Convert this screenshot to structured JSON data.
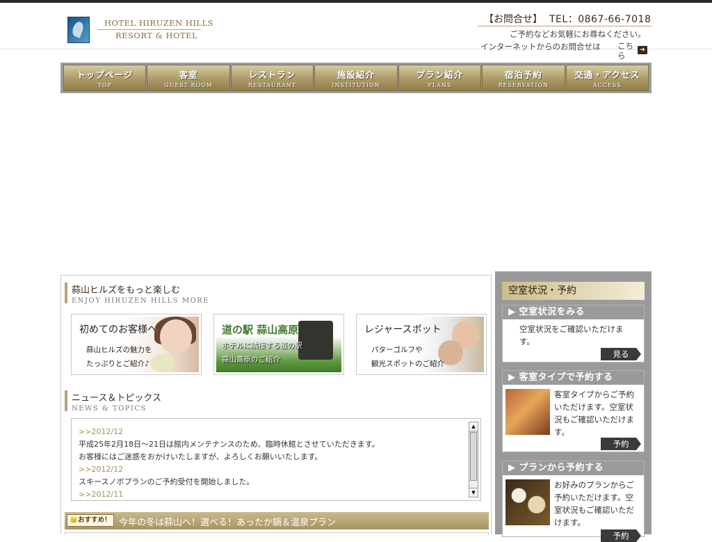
{
  "header": {
    "logo_line1": "HOTEL HIRUZEN HILLS",
    "logo_line2": "RESORT & HOTEL",
    "contact_title": "【お問合せ】",
    "contact_tel": "TEL：0867-66-7018",
    "contact_line1": "ご予約などお気軽にお尋ねください。",
    "contact_line2": "インターネットからのお問合せは",
    "contact_more": "こちら"
  },
  "nav": [
    {
      "jp": "トップページ",
      "en": "TOP"
    },
    {
      "jp": "客室",
      "en": "GUEST ROOM"
    },
    {
      "jp": "レストラン",
      "en": "RESTAURANT"
    },
    {
      "jp": "施設紹介",
      "en": "INSTITUTION"
    },
    {
      "jp": "プラン紹介",
      "en": "PLANS"
    },
    {
      "jp": "宿泊予約",
      "en": "RESERVATION"
    },
    {
      "jp": "交通・アクセス",
      "en": "ACCESS"
    }
  ],
  "enjoy": {
    "title_jp": "蒜山ヒルズをもっと楽しむ",
    "title_en": "ENJOY HIRUZEN HILLS MORE",
    "banners": [
      {
        "title": "初めてのお客様へ",
        "sub1": "蒜山ヒルズの魅力を",
        "sub2": "たっぷりとご紹介♪"
      },
      {
        "title": "道の駅 蒜山高原",
        "sub1": "ホテルに隣接する道の駅",
        "sub2": "蒜山高原のご紹介"
      },
      {
        "title": "レジャースポット",
        "sub1": "パターゴルフや",
        "sub2": "観光スポットのご紹介"
      }
    ]
  },
  "news": {
    "title_jp": "ニュース＆トピックス",
    "title_en": "NEWS & TOPICS",
    "items": [
      {
        "date": ">>2012/12",
        "lines": [
          "平成25年2月18日～21日は館内メンテナンスのため、臨時休館とさせていただきます。",
          "お客様にはご迷惑をおかけいたしますが、よろしくお願いいたします。"
        ]
      },
      {
        "date": ">>2012/12",
        "lines": [
          "スキースノボプランのご予約受付を開始しました。"
        ]
      },
      {
        "date": ">>2012/11",
        "lines": []
      }
    ]
  },
  "promo": {
    "badge": "おすすめ！",
    "text": "今年の冬は蒜山へ！選べる！あったか鍋＆温泉プラン"
  },
  "sidebar": {
    "title": "空室状況・予約",
    "panels": [
      {
        "head": "▶ 空室状況をみる",
        "text": "空室状況をご確認いただけます。",
        "button": "見る"
      },
      {
        "head": "▶ 客室タイプで予約する",
        "text": "客室タイプからご予約いただけます。空室状況もご確認いただけます。",
        "button": "予約"
      },
      {
        "head": "▶ プランから予約する",
        "text": "お好みのプランからご予約いただけます。空室状況もご確認いただけます。",
        "button": "予約"
      }
    ]
  }
}
